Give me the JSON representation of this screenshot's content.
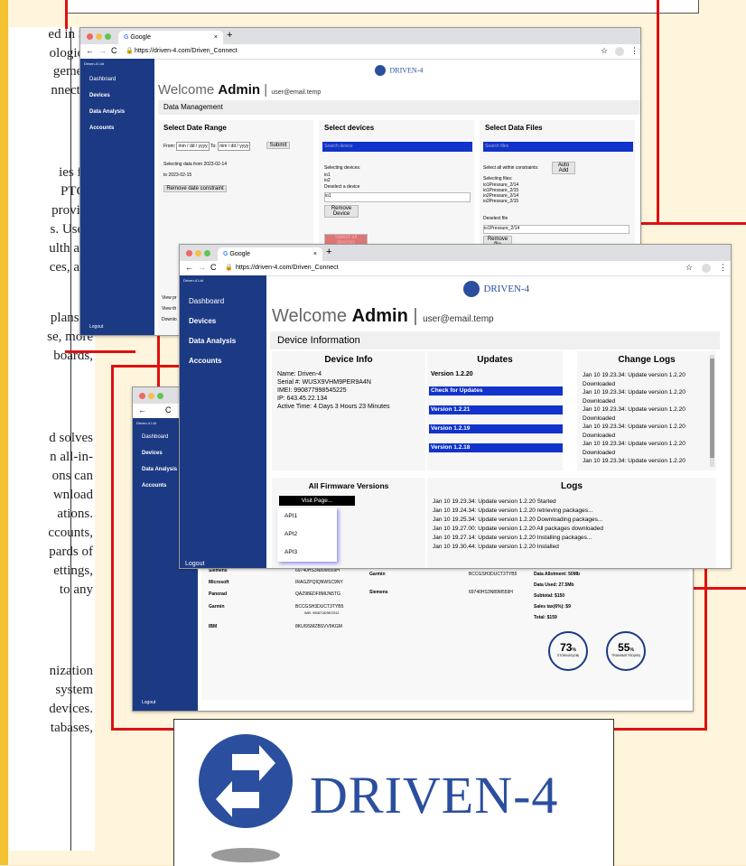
{
  "document": {
    "lines": [
      "ed in St.",
      "ological",
      "gement",
      "nnected",
      "ies for",
      "PTC's",
      "provide",
      "s. Users",
      "ulth and",
      "ces, and",
      "plans to",
      "se, more",
      "boards,",
      "d solves",
      "n all-in-",
      "ons can",
      "wnload",
      "ations.",
      "ccounts,",
      "pards of",
      "ettings,",
      "to any",
      "nization",
      "system",
      "devices.",
      "tabases,"
    ]
  },
  "window1": {
    "tab_title": "Google",
    "url": "https://driven-4.com/Driven_Connect",
    "logo_text": "DRIVEN-4",
    "sidebar_header": "Driven-4 Ltd",
    "sidebar": [
      "Dashboard",
      "Devices",
      "Data Analysis",
      "Accounts"
    ],
    "logout": "Logout",
    "welcome": "Welcome",
    "welcome_name": "Admin",
    "welcome_email": "user@email.temp",
    "section_title": "Data Management",
    "date_card": {
      "title": "Select Date Range",
      "from_label": "From:",
      "date_placeholder": "mm / dd / yyyy",
      "to_label": "To:",
      "submit": "Submit",
      "info1": "Selecting data from 2023-02-14",
      "info2": "to 2023-02-15",
      "remove": "Remove date constraint"
    },
    "devices_card": {
      "title": "Select devices",
      "search_placeholder": "Search device",
      "selecting": "Selecting devices:",
      "items": [
        "io1",
        "io2"
      ],
      "deselect": "Deselect a device",
      "select_value": "io1",
      "remove": "Remove Device",
      "add_all": "Select all devices"
    },
    "files_card": {
      "title": "Select Data Files",
      "search_placeholder": "Search files",
      "select_all": "Select all within constraints:",
      "auto_add": "Auto Add",
      "selecting": "Selecting files:",
      "files": [
        "io1Pressure_2/14",
        "io1Pressure_2/15",
        "io2Pressure_2/14",
        "io2Pressure_2/15"
      ],
      "deselect": "Deselect file",
      "select_value": "io1Pressure_2/14",
      "remove": "Remove file"
    },
    "bottom_texts": [
      "View pr",
      "View th",
      "Downlo"
    ]
  },
  "window2": {
    "tab_title": "Google",
    "url": "https://driven-4.com/Driven_Connect",
    "logo_text": "DRIVEN-4",
    "sidebar_header": "Driven-4 Ltd",
    "sidebar": [
      "Dashboard",
      "Devices",
      "Data Analysis",
      "Accounts"
    ],
    "logout": "Logout",
    "welcome": "Welcome",
    "welcome_name": "Admin",
    "welcome_email": "user@email.temp",
    "section_title": "Device Information",
    "device_info": {
      "title": "Device Info",
      "name": "Name: Driven-4",
      "serial": "Serial #: WUSX9VHM9PER9A4N",
      "imei": "IMEI: 990877998545225",
      "ip": "IP: 643.45.22.134",
      "active": "Active Time: 4 Days 3 Hours 23 Minutes"
    },
    "updates": {
      "title": "Updates",
      "current": "Version 1.2.20",
      "check": "Check for Updates",
      "versions": [
        "Version 1.2.21",
        "Version 1.2.19",
        "Version 1.2.18"
      ]
    },
    "change_logs": {
      "title": "Change Logs",
      "entries": [
        "Jan 10 19.23.34: Update version 1.2.20",
        "Downloaded",
        "Jan 10 19.23.34: Update version 1.2.20",
        "Downloaded",
        "Jan 10 19.23.34: Update version 1.2.20",
        "Downloaded",
        "Jan 10 19.23.34: Update version 1.2.20",
        "Downloaded",
        "Jan 10 19.23.34: Update version 1.2.20",
        "Downloaded",
        "Jan 10 19.23.34: Update version 1.2.20"
      ]
    },
    "firmware": {
      "title": "All Firmware Versions",
      "visit": "Visit Page...",
      "apis": [
        "API1",
        "API2",
        "API3"
      ]
    },
    "logs": {
      "title": "Logs",
      "entries": [
        "Jan 10 19.23.34: Update version 1.2.20 Started",
        "Jan 10 19.24.34: Update version 1.2.20 retrieving packages...",
        "Jan 10 19.25.34: Update version 1.2.20 Downloading packages...",
        "Jan 10 19.27.00: Update version 1.2.20 All packages downloaded",
        "Jan 10 19.27.14: Update version 1.2.20 Installing packages...",
        "Jan 10 19.30.44: Update version 1.2.20 Installed"
      ]
    }
  },
  "window3": {
    "sidebar_header": "Driven-4 Ltd",
    "sidebar": [
      "Dashboard",
      "Devices",
      "Data Analysis",
      "Accounts"
    ],
    "logout": "Logout",
    "companies": [
      {
        "name": "Siemens",
        "code": "69740HS3N89M559H"
      },
      {
        "name": "Microsoft",
        "code": "IRAGZPQIQNWSC9NY"
      },
      {
        "name": "Panorad",
        "code": "QAZ98EDF8MIJN5TG"
      },
      {
        "name": "Garmin",
        "code": "BCCGSH3DUCT3TYB5"
      },
      {
        "name": "IBM",
        "code": "8KUI9SMZBSVV9KGM"
      }
    ],
    "garmin_imei": "IMEI: 990871829872512",
    "mid_companies": [
      {
        "name": "Garmin",
        "code": "BCCGSH3DUCT3TYB5"
      },
      {
        "name": "Siemens",
        "code": "69740HS3N89M559H"
      }
    ],
    "billing": [
      "Data Allotment: 50Mb",
      "Data Used: 27.5Mb",
      "Subtotal: $150",
      "Sales tax(6%): $9",
      "Total: $159"
    ],
    "gauge1": {
      "value": "73",
      "unit": "%",
      "label": "STORAGE(GB)"
    },
    "gauge2": {
      "value": "55",
      "unit": "%",
      "label": "TRANSMITTED(KB)"
    }
  },
  "logo": {
    "text": "DRIVEN-4"
  },
  "colors": {
    "accent": "#1133cc",
    "sidebar": "#1c3a84",
    "red": "#d11111",
    "logo_blue": "#2b4f9e"
  }
}
